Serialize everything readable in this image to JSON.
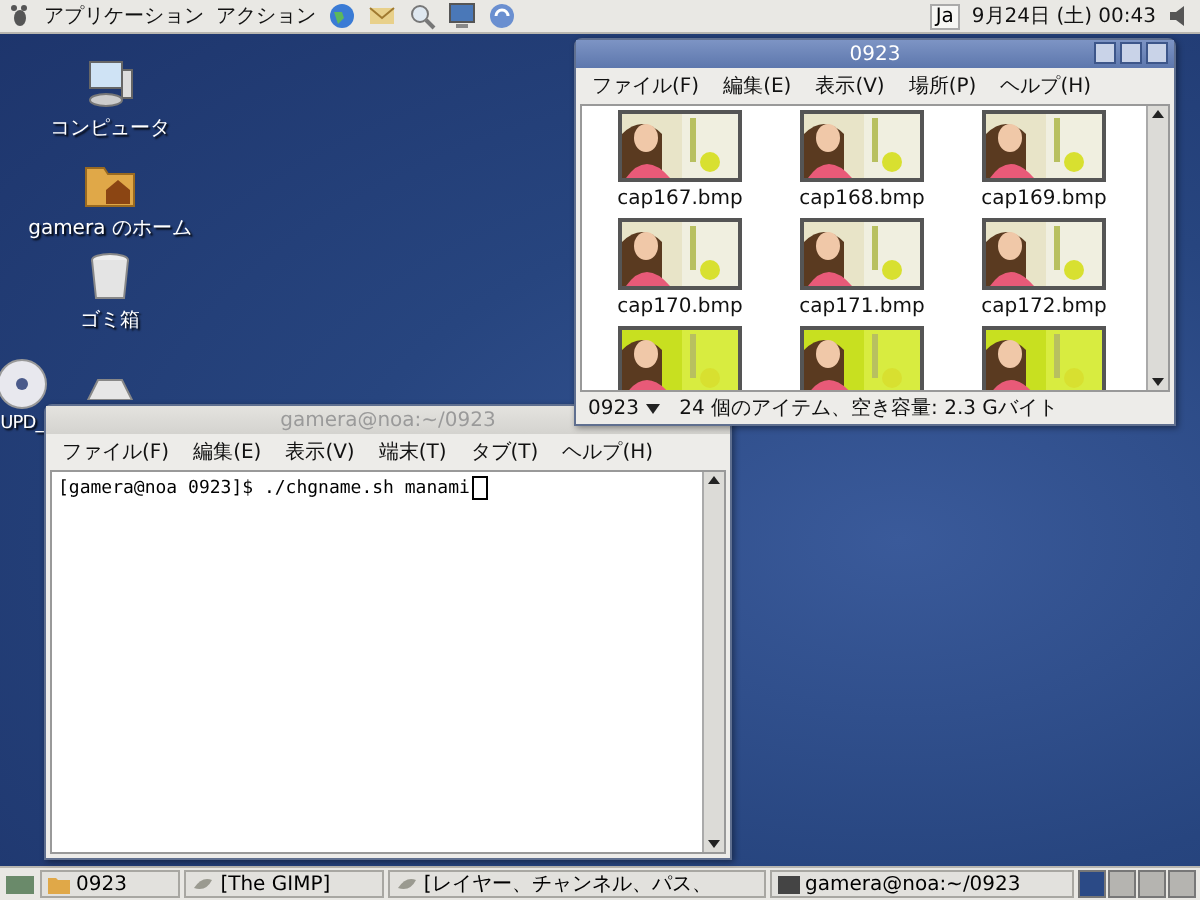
{
  "top_panel": {
    "menus": [
      "アプリケーション",
      "アクション"
    ],
    "launchers": [
      {
        "kind": "globe"
      },
      {
        "kind": "mail"
      },
      {
        "kind": "search"
      },
      {
        "kind": "monitor"
      },
      {
        "kind": "update"
      }
    ],
    "input_method": "Ja",
    "clock": "9月24日 (土) 00:43"
  },
  "desktop_icons": [
    {
      "kind": "computer",
      "label": "コンピュータ"
    },
    {
      "kind": "home",
      "label": "gamera のホーム"
    },
    {
      "kind": "trash",
      "label": "ゴミ箱"
    },
    {
      "kind": "disc",
      "label": "UPD_"
    },
    {
      "kind": "drive"
    }
  ],
  "file_manager": {
    "title": "0923",
    "menu": [
      "ファイル(F)",
      "編集(E)",
      "表示(V)",
      "場所(P)",
      "ヘルプ(H)"
    ],
    "files": [
      {
        "name": "cap167.bmp",
        "kind": "picture"
      },
      {
        "name": "cap168.bmp",
        "kind": "picture"
      },
      {
        "name": "cap169.bmp",
        "kind": "picture"
      },
      {
        "name": "cap170.bmp",
        "kind": "picture"
      },
      {
        "name": "cap171.bmp",
        "kind": "picture"
      },
      {
        "name": "cap172.bmp",
        "kind": "picture"
      },
      {
        "kind": "picture"
      },
      {
        "kind": "picture"
      },
      {
        "kind": "picture"
      }
    ],
    "location": "0923",
    "status": "24 個のアイテム、空き容量: 2.3 Gバイト"
  },
  "terminal": {
    "title": "gamera@noa:~/0923",
    "menu": [
      "ファイル(F)",
      "編集(E)",
      "表示(V)",
      "端末(T)",
      "タブ(T)",
      "ヘルプ(H)"
    ],
    "prompt": "[gamera@noa 0923]$ ./chgname.sh manami"
  },
  "taskbar": {
    "items": [
      {
        "kind": "folder",
        "label": "0923"
      },
      {
        "kind": "gimp",
        "label": "[The GIMP]"
      },
      {
        "kind": "gimp",
        "label": "[レイヤー、チャンネル、パス、"
      },
      {
        "kind": "terminal",
        "label": "gamera@noa:~/0923"
      }
    ],
    "workspaces": [
      {
        "selected": true
      },
      {
        "selected": false
      },
      {
        "selected": false
      },
      {
        "selected": false
      }
    ]
  }
}
